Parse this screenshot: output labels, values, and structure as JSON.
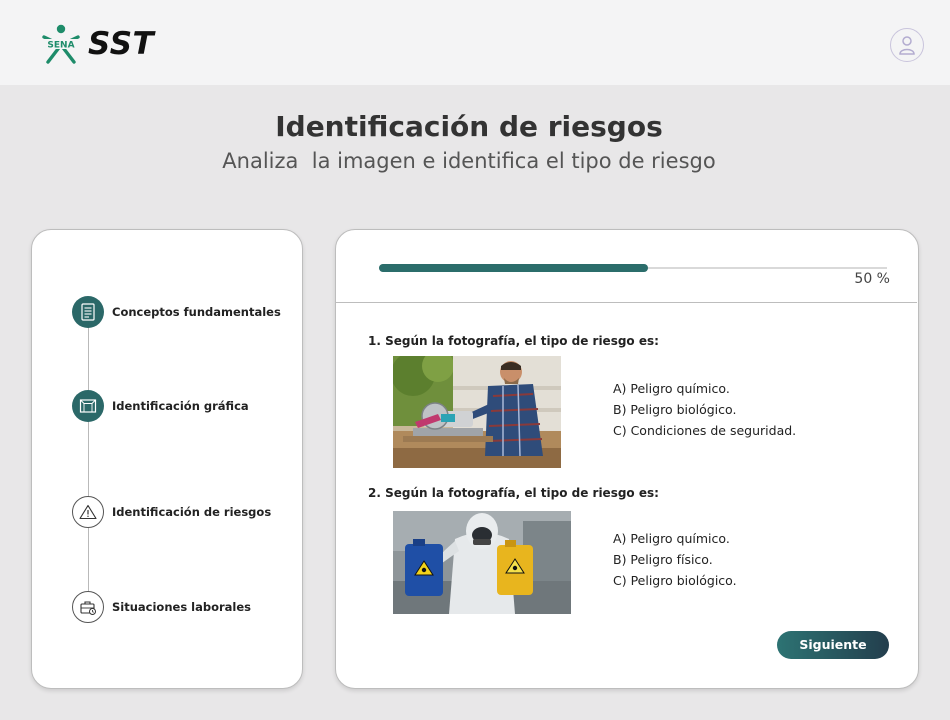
{
  "header": {
    "logo_small_text": "SENA",
    "logo_text": "SST",
    "user_icon": "user-icon"
  },
  "page": {
    "title": "Identificación de riesgos",
    "subtitle": "Analiza  la imagen e identifica el tipo de riesgo"
  },
  "sidebar": {
    "steps": [
      {
        "label": "Conceptos fundamentales",
        "icon": "document-icon",
        "state": "completed"
      },
      {
        "label": "Identificación gráfica",
        "icon": "image-icon",
        "state": "completed"
      },
      {
        "label": "Identificación de riesgos",
        "icon": "warning-icon",
        "state": "current"
      },
      {
        "label": "Situaciones laborales",
        "icon": "briefcase-icon",
        "state": "pending"
      }
    ]
  },
  "progress": {
    "value_fraction": 0.53,
    "label": "50 %"
  },
  "questions": [
    {
      "text": "1. Según la fotografía, el tipo de riesgo es:",
      "image": "worker-with-miter-saw-photo",
      "options": [
        "A) Peligro químico.",
        "B) Peligro biológico.",
        "C) Condiciones de seguridad."
      ]
    },
    {
      "text": "2. Según la fotografía, el tipo de riesgo es:",
      "image": "hazmat-worker-with-containers-photo",
      "options": [
        "A) Peligro químico.",
        "B) Peligro físico.",
        "C) Peligro biológico."
      ]
    }
  ],
  "next_button": {
    "label": "Siguiente"
  },
  "colors": {
    "accent": "#2b6d6b",
    "logo_green": "#1e8c6a",
    "background": "#e8e7e8"
  }
}
